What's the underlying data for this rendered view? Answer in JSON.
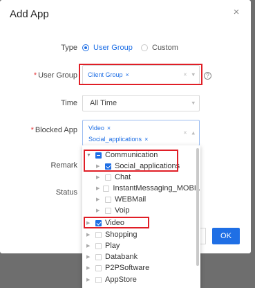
{
  "dialog": {
    "title": "Add App",
    "close_glyph": "×"
  },
  "labels": {
    "type": "Type",
    "user_group": "User Group",
    "time": "Time",
    "blocked_app": "Blocked App",
    "remark": "Remark",
    "status": "Status",
    "required_mark": "*"
  },
  "type_options": [
    {
      "label": "User Group",
      "selected": true
    },
    {
      "label": "Custom",
      "selected": false
    }
  ],
  "user_group": {
    "tags": [
      "Client Group"
    ],
    "help": "?"
  },
  "time": {
    "value": "All Time"
  },
  "blocked_app": {
    "tags": [
      "Video",
      "Social_applications"
    ]
  },
  "tree": [
    {
      "label": "Communication",
      "state": "partial",
      "expanded": true,
      "level": 0
    },
    {
      "label": "Social_applications",
      "state": "checked",
      "expanded": false,
      "level": 1
    },
    {
      "label": "Chat",
      "state": "unchecked",
      "expanded": false,
      "level": 1
    },
    {
      "label": "InstantMessaging_MOBI...",
      "state": "unchecked",
      "expanded": false,
      "level": 1
    },
    {
      "label": "WEBMail",
      "state": "unchecked",
      "expanded": false,
      "level": 1
    },
    {
      "label": "Voip",
      "state": "unchecked",
      "expanded": false,
      "level": 1
    },
    {
      "label": "Video",
      "state": "checked",
      "expanded": false,
      "level": 0
    },
    {
      "label": "Shopping",
      "state": "unchecked",
      "expanded": false,
      "level": 0
    },
    {
      "label": "Play",
      "state": "unchecked",
      "expanded": false,
      "level": 0
    },
    {
      "label": "Databank",
      "state": "unchecked",
      "expanded": false,
      "level": 0
    },
    {
      "label": "P2PSoftware",
      "state": "unchecked",
      "expanded": false,
      "level": 0
    },
    {
      "label": "AppStore",
      "state": "unchecked",
      "expanded": false,
      "level": 0
    }
  ],
  "buttons": {
    "ok": "OK"
  },
  "colors": {
    "accent": "#1f6fe5",
    "highlight": "#e01e26",
    "required": "#e4393c"
  }
}
